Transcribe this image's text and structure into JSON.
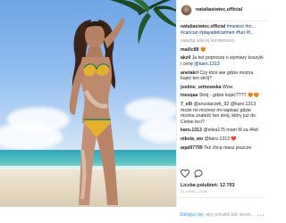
{
  "post": {
    "username": "nataliasiwiec.official"
  },
  "caption": {
    "username": "nataliasiwiec.official",
    "text": "#mexico #m... #cancun #playadelcarmen #fun #f..."
  },
  "load_more": "załaduj więcej komentarzy",
  "comments": [
    {
      "user": "mailic88",
      "text": "😍"
    },
    {
      "user": "akzil",
      "text": "Ja też poproszę o wymiary koszyki i cenę"
    },
    {
      "user": "",
      "text": "@karo.1313"
    },
    {
      "user": "anetakrl",
      "text": "Czy ktoś wie gdzie można kupić ten strój?"
    },
    {
      "user": "justine_urtnowska",
      "text": "Wow"
    },
    {
      "user": "inesqaa",
      "text": "Strój - gdzie kupić???? 😍😍"
    },
    {
      "user": "7_elli",
      "text": "@anusiaczek_92 @karo.1313 może mi możesz mi napisać gdzie można znaleźć ten strój, który już do Ciebie leci?"
    },
    {
      "user": "karo.1313",
      "text": "@elisa175 mam M za 44zł"
    },
    {
      "user": "nikola_wo",
      "text": "@karo.1313 ❤️"
    },
    {
      "user": "aqal97799",
      "text": "Też chcę masz jeszcze"
    }
  ],
  "likes": "Liczba polubień: 12 703",
  "date": "31 LIPIEC 2016",
  "login_bar": {
    "login": "Zaloguj się",
    "rest": ", aby polubić lub skom...",
    "more": "···"
  },
  "icons": {
    "like": "heart-icon",
    "comment": "comment-icon"
  }
}
